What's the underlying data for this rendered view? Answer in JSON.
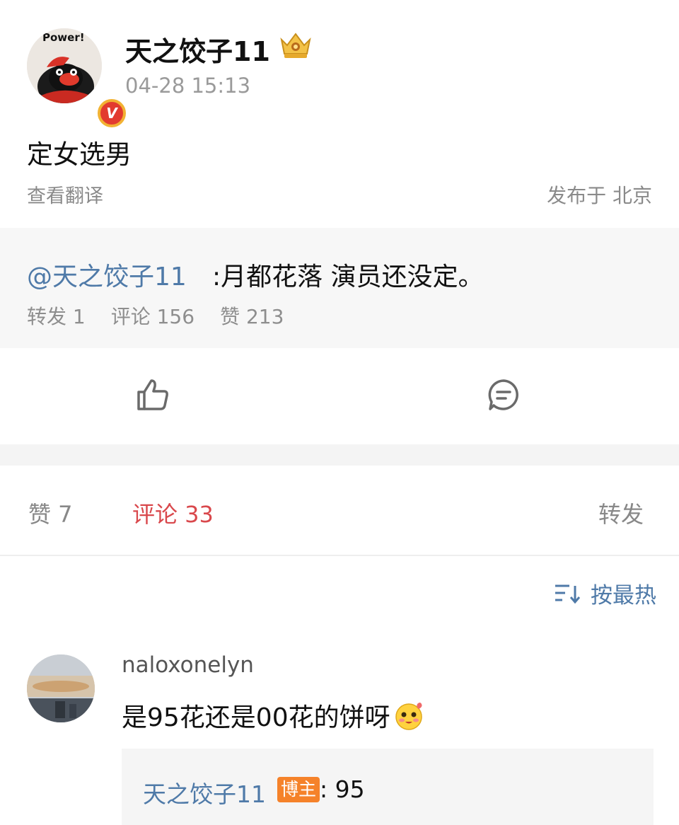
{
  "post": {
    "author": "天之饺子11",
    "timestamp": "04-28 15:13",
    "avatar_text": "Power!",
    "verified_mark": "V",
    "text": "定女选男",
    "translate_label": "查看翻译",
    "location": "发布于 北京"
  },
  "quote": {
    "mention": "@天之饺子11",
    "text": ":月都花落 演员还没定。",
    "stats": {
      "repost": "转发 1",
      "comment": "评论 156",
      "like": "赞 213"
    }
  },
  "tabs": {
    "like": "赞 7",
    "comment": "评论 33",
    "repost": "转发"
  },
  "sort": {
    "label": "按最热"
  },
  "comment": {
    "user": "naloxonelyn",
    "text": "是95花还是00花的饼呀",
    "reply": {
      "user": "天之饺子11",
      "badge": "博主",
      "text": ": 95"
    }
  },
  "colors": {
    "link_blue": "#4f7aa8",
    "active_red": "#d9484c",
    "badge_orange": "#f5822a"
  }
}
